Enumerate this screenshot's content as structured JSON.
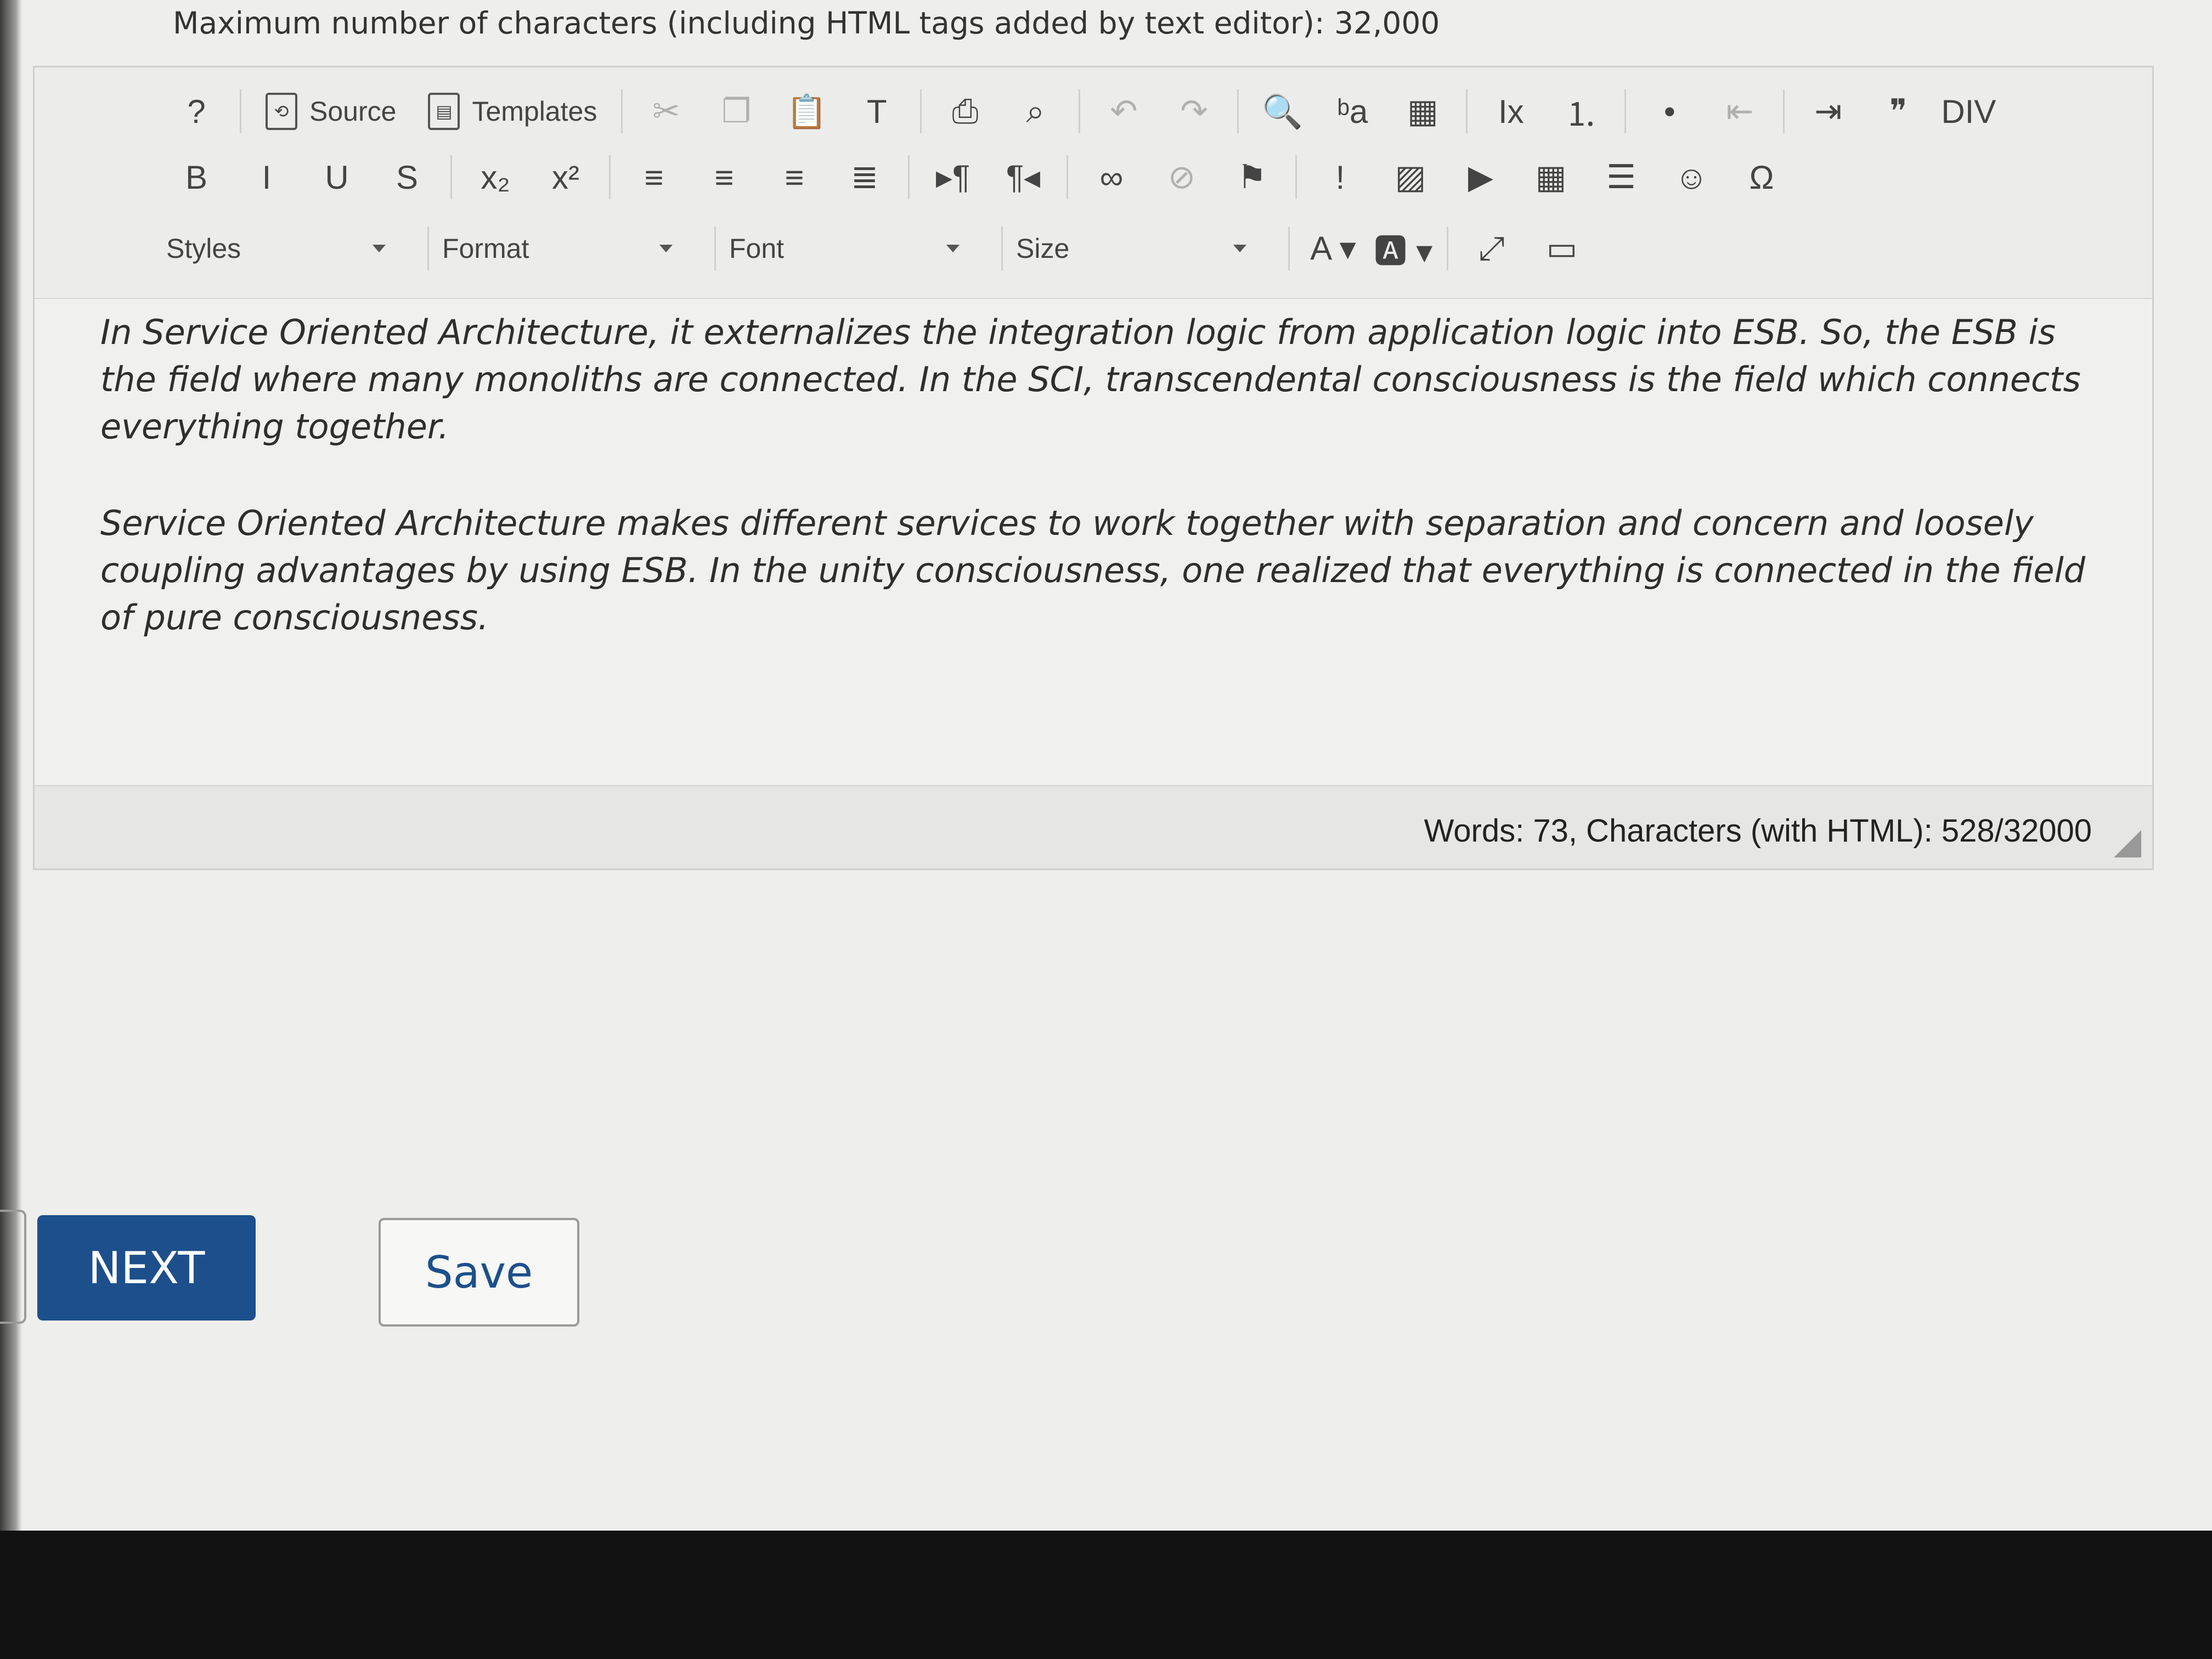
{
  "limit_note": "Maximum number of characters (including HTML tags added by text editor): 32,000",
  "toolbar": {
    "row1": [
      {
        "name": "help-icon",
        "glyph": "?"
      },
      {
        "name": "source-button",
        "label": "Source",
        "glyph": "⟲"
      },
      {
        "name": "templates-button",
        "label": "Templates",
        "glyph": "▤"
      },
      {
        "name": "cut-icon",
        "glyph": "✂"
      },
      {
        "name": "copy-icon",
        "glyph": "❐"
      },
      {
        "name": "paste-icon",
        "glyph": "📋"
      },
      {
        "name": "paste-text-icon",
        "glyph": "T"
      },
      {
        "name": "print-icon",
        "glyph": "⎙"
      },
      {
        "name": "preview-icon",
        "glyph": "⌕"
      },
      {
        "name": "undo-icon",
        "glyph": "↶"
      },
      {
        "name": "redo-icon",
        "glyph": "↷"
      },
      {
        "name": "find-icon",
        "glyph": "🔍"
      },
      {
        "name": "replace-icon",
        "glyph": "ᵇa"
      },
      {
        "name": "select-all-icon",
        "glyph": "▦"
      },
      {
        "name": "remove-format-icon",
        "glyph": "Ix"
      },
      {
        "name": "numbered-list-icon",
        "glyph": "⒈"
      },
      {
        "name": "bulleted-list-icon",
        "glyph": "•"
      },
      {
        "name": "outdent-icon",
        "glyph": "⇤"
      },
      {
        "name": "indent-icon",
        "glyph": "⇥"
      },
      {
        "name": "blockquote-icon",
        "glyph": "❞"
      },
      {
        "name": "div-icon",
        "glyph": "DIV"
      }
    ],
    "row2": [
      {
        "name": "bold-icon",
        "glyph": "B"
      },
      {
        "name": "italic-icon",
        "glyph": "I"
      },
      {
        "name": "underline-icon",
        "glyph": "U"
      },
      {
        "name": "strikethrough-icon",
        "glyph": "S"
      },
      {
        "name": "subscript-icon",
        "glyph": "x₂"
      },
      {
        "name": "superscript-icon",
        "glyph": "x²"
      },
      {
        "name": "align-left-icon",
        "glyph": "≡"
      },
      {
        "name": "align-center-icon",
        "glyph": "≡"
      },
      {
        "name": "align-right-icon",
        "glyph": "≡"
      },
      {
        "name": "justify-icon",
        "glyph": "≣"
      },
      {
        "name": "ltr-icon",
        "glyph": "▸¶"
      },
      {
        "name": "rtl-icon",
        "glyph": "¶◂"
      },
      {
        "name": "link-icon",
        "glyph": "∞"
      },
      {
        "name": "unlink-icon",
        "glyph": "⊘"
      },
      {
        "name": "anchor-icon",
        "glyph": "⚑"
      },
      {
        "name": "marker-icon",
        "glyph": "!"
      },
      {
        "name": "image-icon",
        "glyph": "▨"
      },
      {
        "name": "video-icon",
        "glyph": "▶"
      },
      {
        "name": "table-icon",
        "glyph": "▦"
      },
      {
        "name": "horizontal-line-icon",
        "glyph": "☰"
      },
      {
        "name": "smiley-icon",
        "glyph": "☺"
      },
      {
        "name": "special-char-icon",
        "glyph": "Ω"
      }
    ],
    "combos": {
      "styles": "Styles",
      "format": "Format",
      "font": "Font",
      "size": "Size"
    },
    "row3_icons": [
      {
        "name": "text-color-icon",
        "glyph": "A ▾"
      },
      {
        "name": "bg-color-icon",
        "glyph": "🅰 ▾"
      },
      {
        "name": "maximize-icon",
        "glyph": "⤢"
      },
      {
        "name": "show-blocks-icon",
        "glyph": "▭"
      }
    ]
  },
  "content": {
    "p1": "In Service Oriented Architecture, it externalizes the integration logic from application logic into ESB. So, the ESB is the field where many monoliths are connected. In the SCI, transcendental consciousness is the field which connects everything together.",
    "p2": "Service Oriented Architecture makes different services to work together with separation and concern and loosely coupling advantages by using ESB. In the unity consciousness, one realized that everything is connected in the field of pure consciousness."
  },
  "status": "Words: 73, Characters (with HTML): 528/32000",
  "buttons": {
    "next": "NEXT",
    "save": "Save"
  }
}
